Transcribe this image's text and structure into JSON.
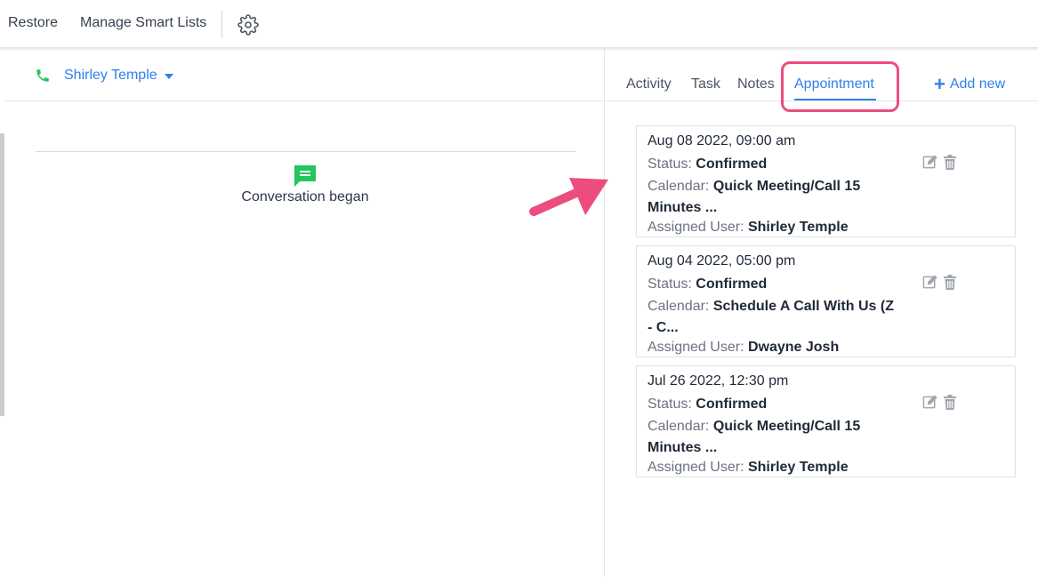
{
  "topbar": {
    "restore_label": "Restore",
    "smart_lists_label": "Manage Smart Lists",
    "settings_icon": "gear-icon"
  },
  "contact": {
    "name": "Shirley Temple",
    "phone_icon": "phone-icon",
    "phone_color": "#22c55e"
  },
  "conversation": {
    "began_text": "Conversation began",
    "icon": "chat-icon",
    "icon_color": "#22c55e"
  },
  "tabs": {
    "activity": "Activity",
    "task": "Task",
    "notes": "Notes",
    "appointment": "Appointment",
    "active": "Appointment",
    "add_new": "Add new"
  },
  "labels": {
    "status": "Status:",
    "calendar": "Calendar:",
    "assigned_user": "Assigned User:"
  },
  "appointments": [
    {
      "date": "Aug 08 2022, 09:00 am",
      "status": "Confirmed",
      "calendar": "Quick Meeting/Call 15 Minutes ...",
      "assigned_user": "Shirley Temple"
    },
    {
      "date": "Aug 04 2022, 05:00 pm",
      "status": "Confirmed",
      "calendar": "Schedule A Call With Us (Z - C...",
      "assigned_user": "Dwayne Josh"
    },
    {
      "date": "Jul 26 2022, 12:30 pm",
      "status": "Confirmed",
      "calendar": "Quick Meeting/Call 15 Minutes ...",
      "assigned_user": "Shirley Temple"
    }
  ],
  "colors": {
    "accent": "#2f80ed",
    "highlight": "#ec4d7e",
    "annotation_arrow": "#ec4d7e"
  }
}
